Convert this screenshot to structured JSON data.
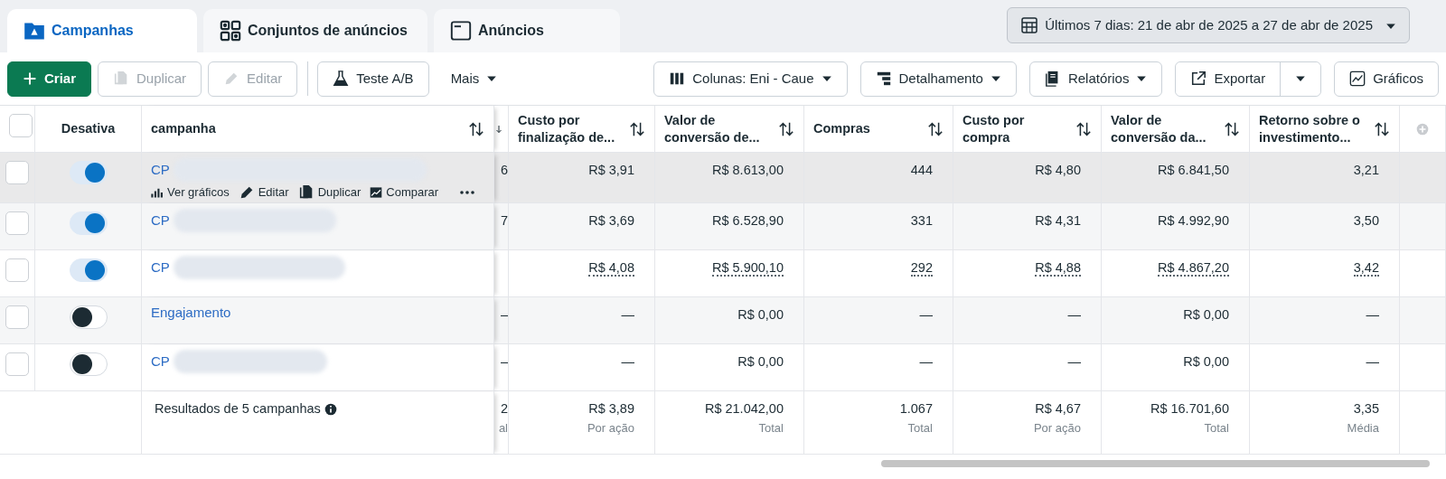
{
  "tabs": [
    {
      "label": "Campanhas",
      "selected": true
    },
    {
      "label": "Conjuntos de anúncios",
      "selected": false
    },
    {
      "label": "Anúncios",
      "selected": false
    }
  ],
  "date_range": {
    "label": "Últimos 7 dias: 21 de abr de 2025 a 27 de abr de 2025"
  },
  "toolbar_left": [
    [
      {
        "label": "Criar",
        "kind": "primary",
        "disabled": false
      },
      {
        "label": "Duplicar",
        "kind": "outline",
        "disabled": true
      },
      {
        "label": "Editar",
        "kind": "outline",
        "disabled": true
      }
    ],
    [
      {
        "label": "Teste A/B",
        "kind": "outline",
        "disabled": false
      },
      {
        "label": "Mais",
        "kind": "plain",
        "disabled": false,
        "dropdown": true
      }
    ]
  ],
  "toolbar_right": [
    {
      "label": "Colunas: Eni - Caue",
      "kind": "outline",
      "dropdown": true
    },
    {
      "label": "Detalhamento",
      "kind": "outline",
      "dropdown": true
    },
    {
      "label": "Relatórios",
      "kind": "outline",
      "dropdown": true
    },
    {
      "label": "Exportar",
      "kind": "split",
      "dropdown": true
    },
    {
      "label": "Gráficos",
      "kind": "outline",
      "dropdown": false
    }
  ],
  "table": {
    "select_all_checked": false,
    "columns": [
      {
        "kind": "toggle",
        "label": "Desativa"
      },
      {
        "kind": "name",
        "label": "campanha"
      },
      {
        "kind": "cut"
      },
      {
        "kind": "metric",
        "label": "Custo por\nfinalização de..."
      },
      {
        "kind": "metric",
        "label": "Valor de\nconversão de..."
      },
      {
        "kind": "metric",
        "label": "Compras"
      },
      {
        "kind": "metric",
        "label": "Custo por\ncompra"
      },
      {
        "kind": "metric",
        "label": "Valor de\nconversão da..."
      },
      {
        "kind": "metric",
        "label": "Retorno sobre o\ninvestimento..."
      }
    ],
    "rows": [
      {
        "checked": false,
        "on": true,
        "hovered": true,
        "estimated": false,
        "name": "CP",
        "redacted": true,
        "cut_value": "6",
        "values": [
          "R$ 3,91",
          "R$ 8.613,00",
          "444",
          "R$ 4,80",
          "R$ 6.841,50",
          "3,21"
        ],
        "actions": [
          "Ver gráficos",
          "Editar",
          "Duplicar",
          "Comparar"
        ]
      },
      {
        "checked": false,
        "on": true,
        "hovered": false,
        "estimated": false,
        "name": "CP",
        "redacted": true,
        "cut_value": "7",
        "values": [
          "R$ 3,69",
          "R$ 6.528,90",
          "331",
          "R$ 4,31",
          "R$ 4.992,90",
          "3,50"
        ]
      },
      {
        "checked": false,
        "on": true,
        "hovered": false,
        "estimated": true,
        "name": "CP",
        "redacted": true,
        "values": [
          "R$ 4,08",
          "R$ 5.900,10",
          "292",
          "R$ 4,88",
          "R$ 4.867,20",
          "3,42"
        ]
      },
      {
        "checked": false,
        "on": false,
        "hovered": false,
        "estimated": false,
        "name": "Engajamento",
        "redacted": false,
        "cut_value": "–",
        "values": [
          "—",
          "R$ 0,00",
          "—",
          "—",
          "R$ 0,00",
          "—"
        ]
      },
      {
        "checked": false,
        "on": false,
        "hovered": false,
        "estimated": false,
        "name": "CP",
        "redacted": true,
        "cut_value": "–",
        "values": [
          "—",
          "R$ 0,00",
          "—",
          "—",
          "R$ 0,00",
          "—"
        ]
      }
    ],
    "footer": {
      "label": "Resultados de 5 campanhas",
      "cut_value": "2",
      "cut_sub": "al",
      "values": [
        {
          "value": "R$ 3,89",
          "sub": "Por ação"
        },
        {
          "value": "R$ 21.042,00",
          "sub": "Total"
        },
        {
          "value": "1.067",
          "sub": "Total"
        },
        {
          "value": "R$ 4,67",
          "sub": "Por ação"
        },
        {
          "value": "R$ 16.701,60",
          "sub": "Total"
        },
        {
          "value": "3,35",
          "sub": "Média"
        }
      ]
    }
  }
}
